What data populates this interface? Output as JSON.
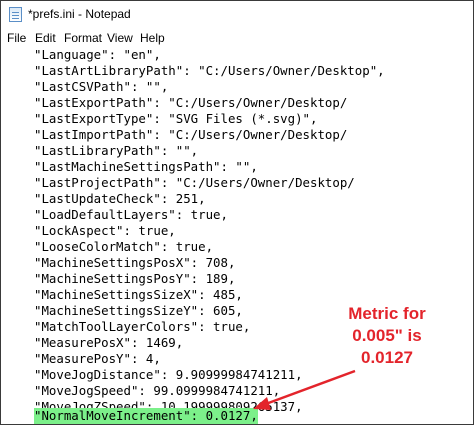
{
  "window": {
    "title": "*prefs.ini - Notepad",
    "icon": "notepad-icon"
  },
  "menu": {
    "items": [
      "File",
      "Edit",
      "Format",
      "View",
      "Help"
    ]
  },
  "editor": {
    "lines": [
      "\"Language\": \"en\",",
      "\"LastArtLibraryPath\": \"C:/Users/Owner/Desktop\",",
      "\"LastCSVPath\": \"\",",
      "\"LastExportPath\": \"C:/Users/Owner/Desktop/",
      "\"LastExportType\": \"SVG Files (*.svg)\",",
      "\"LastImportPath\": \"C:/Users/Owner/Desktop/",
      "\"LastLibraryPath\": \"\",",
      "\"LastMachineSettingsPath\": \"\",",
      "\"LastProjectPath\": \"C:/Users/Owner/Desktop/",
      "\"LastUpdateCheck\": 251,",
      "\"LoadDefaultLayers\": true,",
      "\"LockAspect\": true,",
      "\"LooseColorMatch\": true,",
      "\"MachineSettingsPosX\": 708,",
      "\"MachineSettingsPosY\": 189,",
      "\"MachineSettingsSizeX\": 485,",
      "\"MachineSettingsSizeY\": 605,",
      "\"MatchToolLayerColors\": true,",
      "\"MeasurePosX\": 1469,",
      "\"MeasurePosY\": 4,",
      "\"MoveJogDistance\": 9.90999984741211,",
      "\"MoveJogSpeed\": 99.0999984741211,",
      "\"MoveJogZSpeed\": 10.199999809265137,",
      "\"NormalMoveIncrement\": 0.0127,"
    ],
    "highlighted_line": 23,
    "highlight_color": "#7cf08a"
  },
  "annotation": {
    "lines": [
      "Metric for",
      "0.005\" is",
      "0.0127"
    ],
    "color": "#e3242b"
  }
}
